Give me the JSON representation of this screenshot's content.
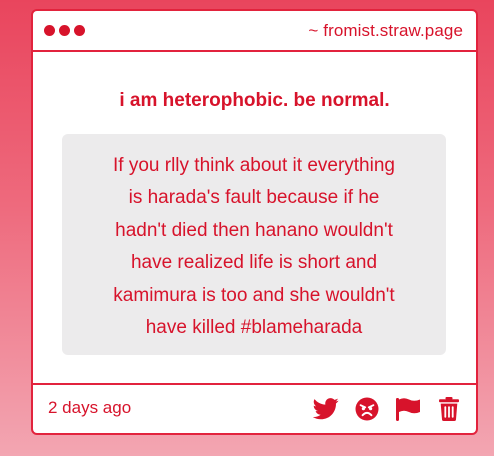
{
  "window": {
    "site_url": "~ fromist.straw.page"
  },
  "post": {
    "headline": "i am heterophobic. be normal.",
    "message_lines": [
      "If you rlly think about it everything",
      "is harada's fault because if he",
      "hadn't died then hanano wouldn't",
      "have realized life is short and",
      "kamimura is too and she wouldn't",
      "have killed #blameharada"
    ],
    "timestamp": "2 days ago"
  },
  "actions": [
    {
      "icon": "twitter-icon"
    },
    {
      "icon": "angry-face-icon"
    },
    {
      "icon": "flag-icon"
    },
    {
      "icon": "trash-icon"
    }
  ],
  "colors": {
    "accent": "#d7132b",
    "message_bg": "#ecebec",
    "card_bg": "#ffffff"
  }
}
